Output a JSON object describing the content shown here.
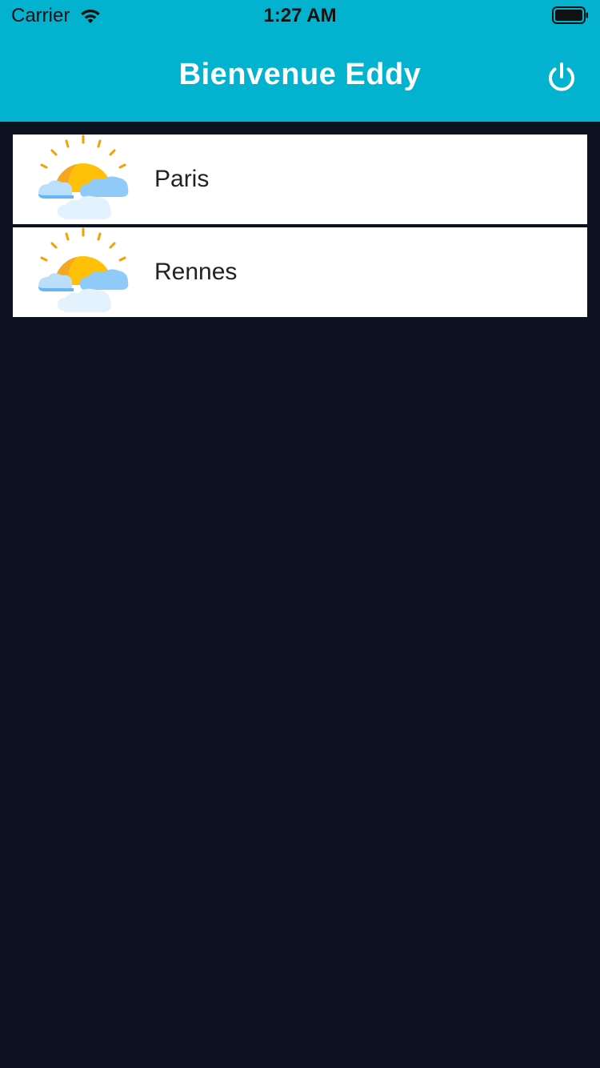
{
  "status_bar": {
    "carrier": "Carrier",
    "time": "1:27 AM",
    "wifi_icon": "wifi-icon",
    "battery_icon": "battery-icon"
  },
  "header": {
    "title": "Bienvenue Eddy",
    "power_icon": "power-icon"
  },
  "cities": [
    {
      "name": "Paris",
      "icon": "partly-sunny-icon"
    },
    {
      "name": "Rennes",
      "icon": "partly-sunny-icon"
    }
  ],
  "colors": {
    "header_bg": "#03b2cf",
    "page_bg": "#0c1220",
    "card_bg": "#ffffff",
    "sun": "#ffc107",
    "cloud": "#90caf9"
  }
}
